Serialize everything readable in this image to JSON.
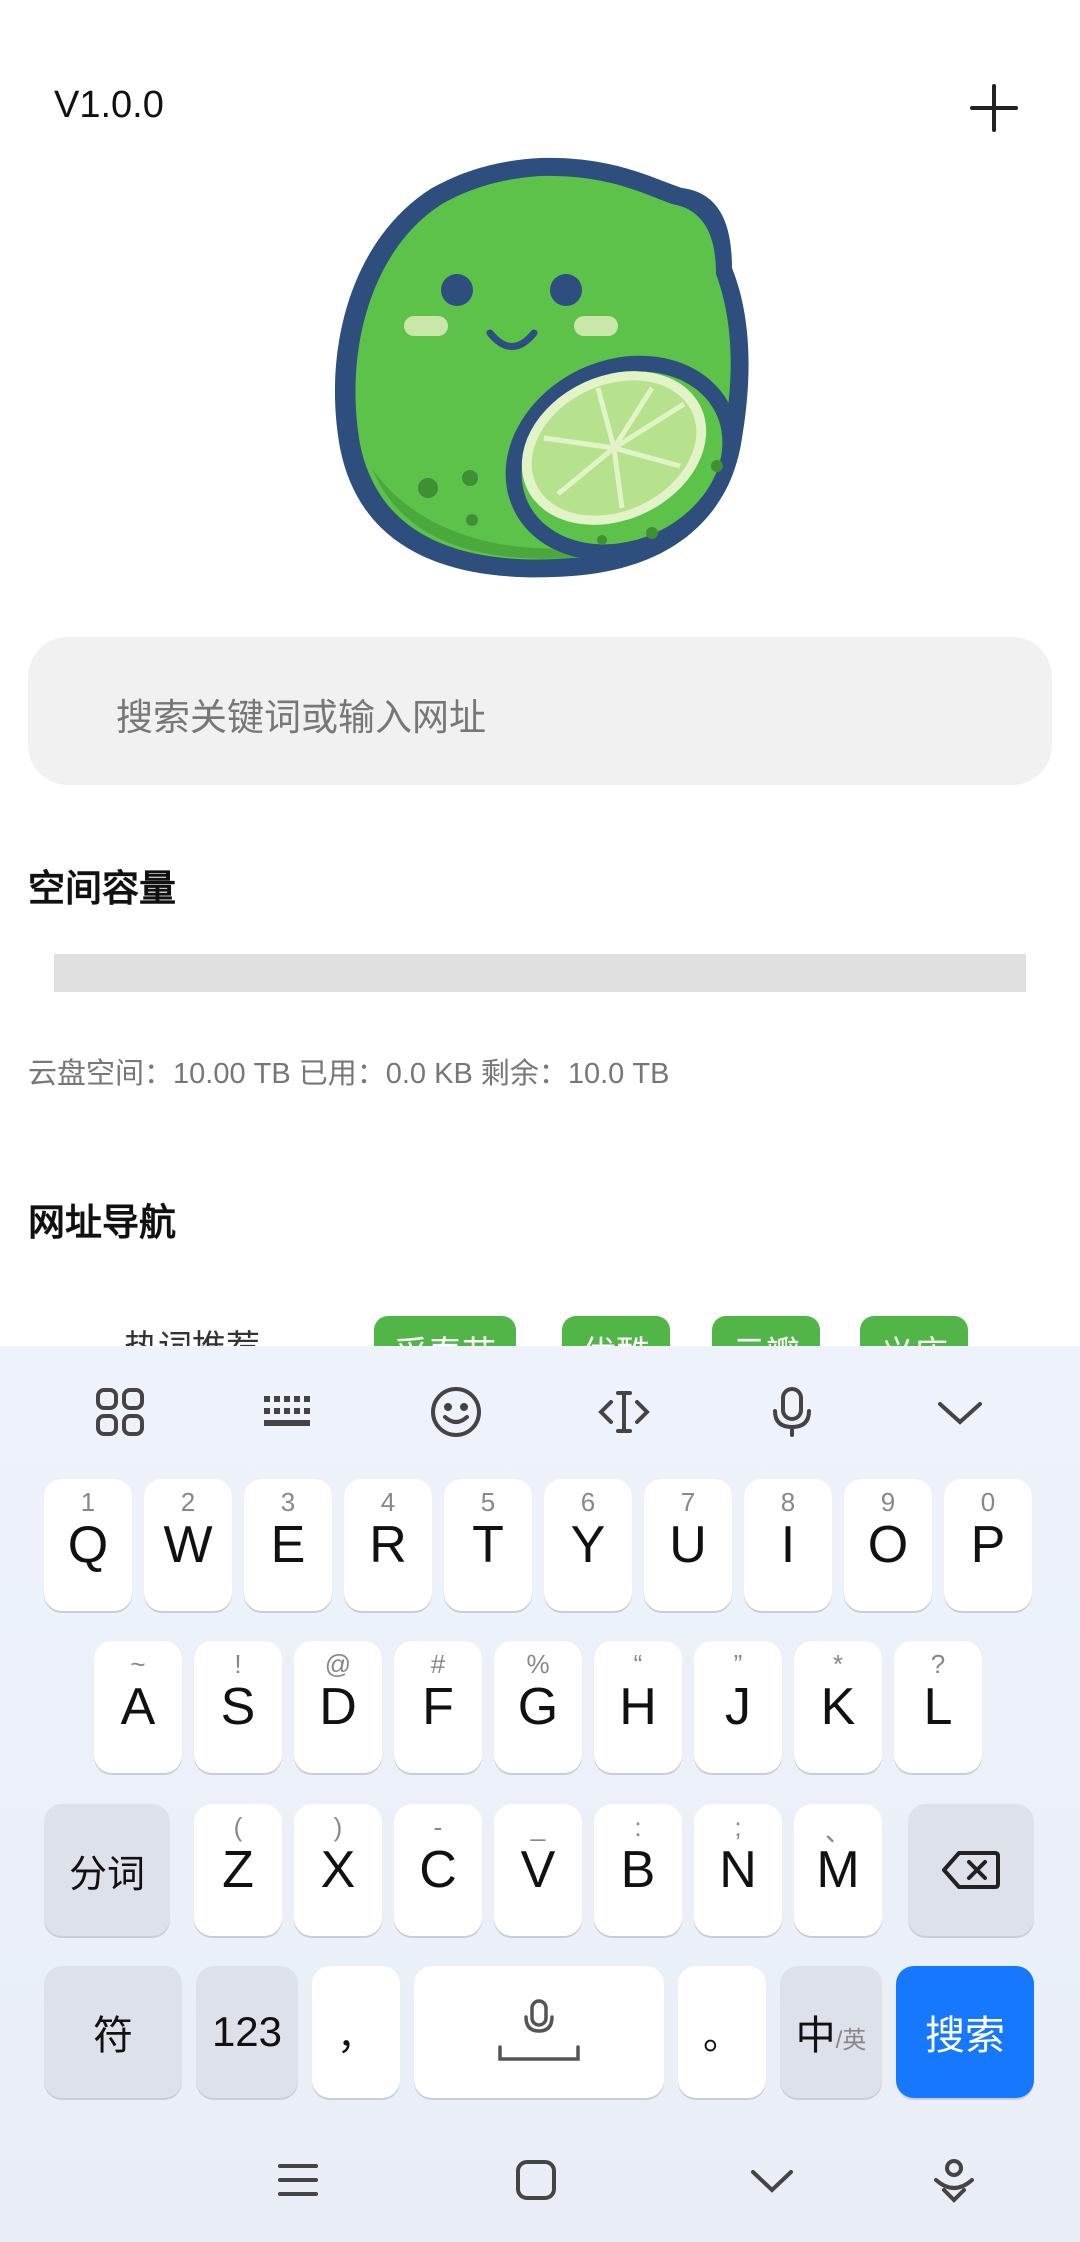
{
  "header": {
    "version": "V1.0.0",
    "add_icon": "plus-icon"
  },
  "mascot": {
    "icon": "lime-mascot-logo"
  },
  "search": {
    "placeholder": "搜索关键词或输入网址"
  },
  "storage": {
    "title": "空间容量",
    "used_fraction": 0,
    "summary": "云盘空间：10.00 TB 已用：0.0 KB 剩余：10.0 TB"
  },
  "navigation": {
    "title": "网址导航",
    "hot_label": "热词推荐",
    "tags": [
      "采春节",
      "优酷",
      "云瓣",
      "义庄"
    ]
  },
  "keyboard": {
    "toolbar": [
      "grid-icon",
      "keyboard-icon",
      "emoji-icon",
      "cursor-icon",
      "microphone-icon",
      "chevron-down-icon"
    ],
    "row1": [
      {
        "main": "Q",
        "sub": "1"
      },
      {
        "main": "W",
        "sub": "2"
      },
      {
        "main": "E",
        "sub": "3"
      },
      {
        "main": "R",
        "sub": "4"
      },
      {
        "main": "T",
        "sub": "5"
      },
      {
        "main": "Y",
        "sub": "6"
      },
      {
        "main": "U",
        "sub": "7"
      },
      {
        "main": "I",
        "sub": "8"
      },
      {
        "main": "O",
        "sub": "9"
      },
      {
        "main": "P",
        "sub": "0"
      }
    ],
    "row2": [
      {
        "main": "A",
        "sub": "~"
      },
      {
        "main": "S",
        "sub": "!"
      },
      {
        "main": "D",
        "sub": "@"
      },
      {
        "main": "F",
        "sub": "#"
      },
      {
        "main": "G",
        "sub": "%"
      },
      {
        "main": "H",
        "sub": "“"
      },
      {
        "main": "J",
        "sub": "”"
      },
      {
        "main": "K",
        "sub": "*"
      },
      {
        "main": "L",
        "sub": "?"
      }
    ],
    "row3": [
      {
        "main": "Z",
        "sub": "("
      },
      {
        "main": "X",
        "sub": ")"
      },
      {
        "main": "C",
        "sub": "-"
      },
      {
        "main": "V",
        "sub": "_"
      },
      {
        "main": "B",
        "sub": ":"
      },
      {
        "main": "N",
        "sub": ";"
      },
      {
        "main": "M",
        "sub": "、"
      }
    ],
    "segment_label": "分词",
    "symbol_label": "符",
    "number_label": "123",
    "comma_label": "，",
    "period_label": "。",
    "lang_main": "中",
    "lang_sub": "/英",
    "search_label": "搜索",
    "accent_color": "#1677ff"
  },
  "system_nav": [
    "menu-icon",
    "home-square-icon",
    "chevron-down-icon",
    "assistant-icon"
  ]
}
